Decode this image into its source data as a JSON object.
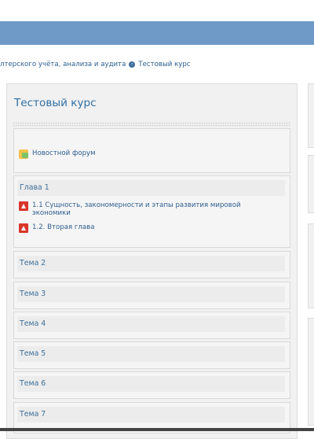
{
  "breadcrumb": {
    "parent": "лтерского учёта, анализа и аудита",
    "current": "Тестовый курс"
  },
  "course": {
    "title": "Тестовый курс",
    "news_forum": "Новостной форум",
    "sections": [
      {
        "title": "Глава 1",
        "activities": [
          {
            "label": "1.1 Сущность, закономерности и этапы развития мировой экономики"
          },
          {
            "label": "1.2. Вторая глава"
          }
        ]
      },
      {
        "title": "Тема 2"
      },
      {
        "title": "Тема 3"
      },
      {
        "title": "Тема 4"
      },
      {
        "title": "Тема 5"
      },
      {
        "title": "Тема 6"
      },
      {
        "title": "Тема 7"
      }
    ]
  },
  "icons": {
    "forum": "forum-icon",
    "resource": "pdf-icon",
    "separator": "breadcrumb-arrow-icon"
  },
  "colors": {
    "header": "#6f9ac7",
    "link": "#2f6fa3"
  }
}
